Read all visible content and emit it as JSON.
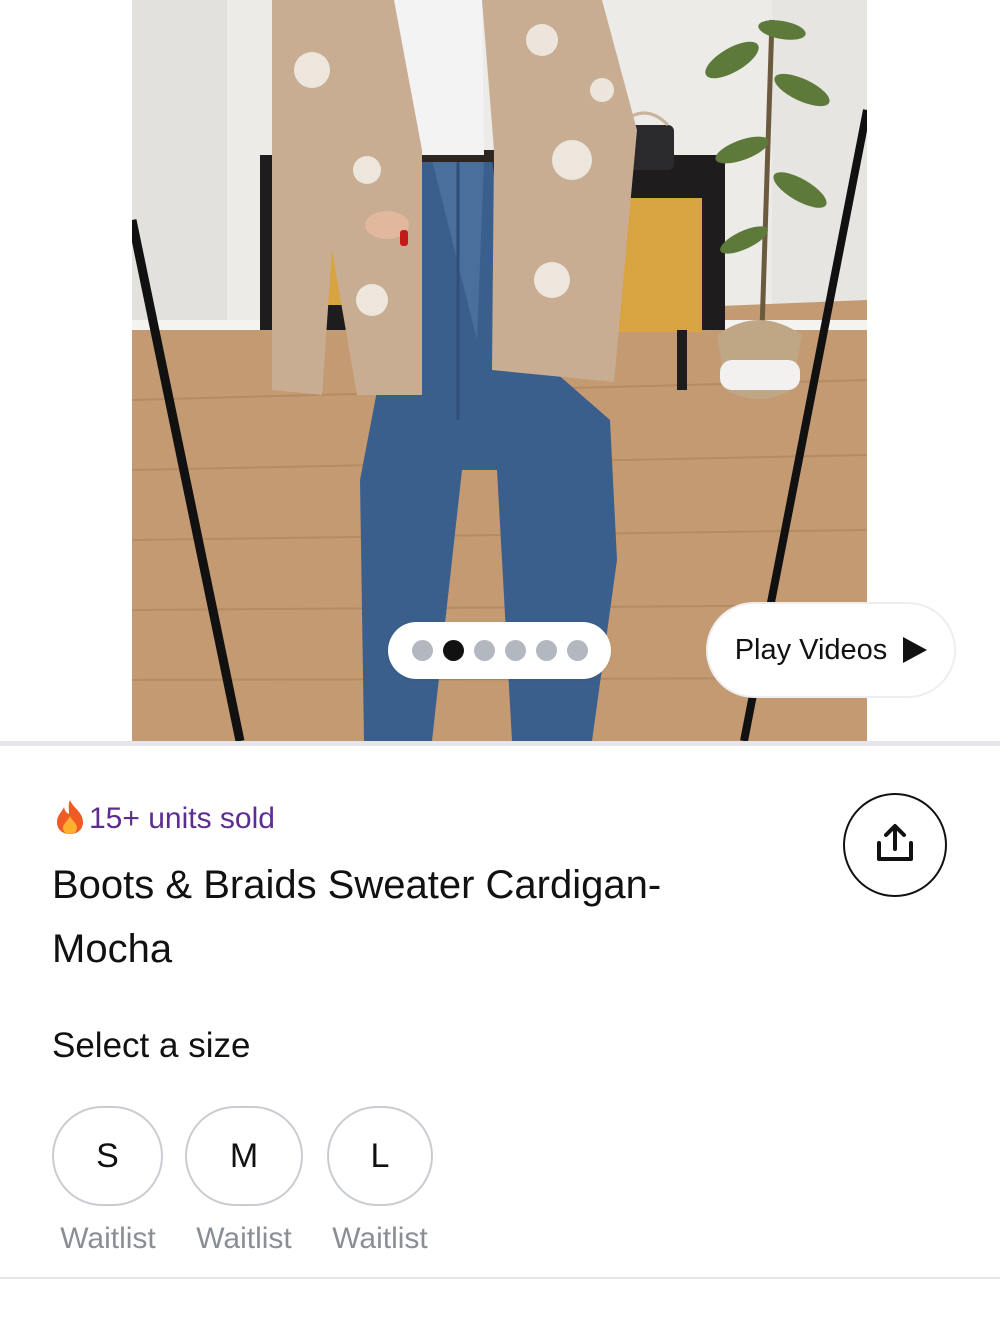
{
  "gallery": {
    "image_alt": "Model wearing mocha patterned cardigan with wide-leg jeans",
    "dot_count": 6,
    "active_index": 1,
    "play_videos_label": "Play Videos"
  },
  "product": {
    "sold_icon": "fire-icon",
    "sold_text": "15+ units sold",
    "title": "Boots & Braids Sweater Cardigan-Mocha",
    "share_icon": "share-icon"
  },
  "sizes": {
    "heading": "Select a size",
    "options": [
      {
        "label": "S",
        "status": "Waitlist"
      },
      {
        "label": "M",
        "status": "Waitlist"
      },
      {
        "label": "L",
        "status": "Waitlist"
      }
    ]
  },
  "colors": {
    "sold_text": "#5d2d91",
    "active_dot": "#111111",
    "inactive_dot": "#b3b7bf",
    "waitlist_text": "#8a8e95"
  }
}
